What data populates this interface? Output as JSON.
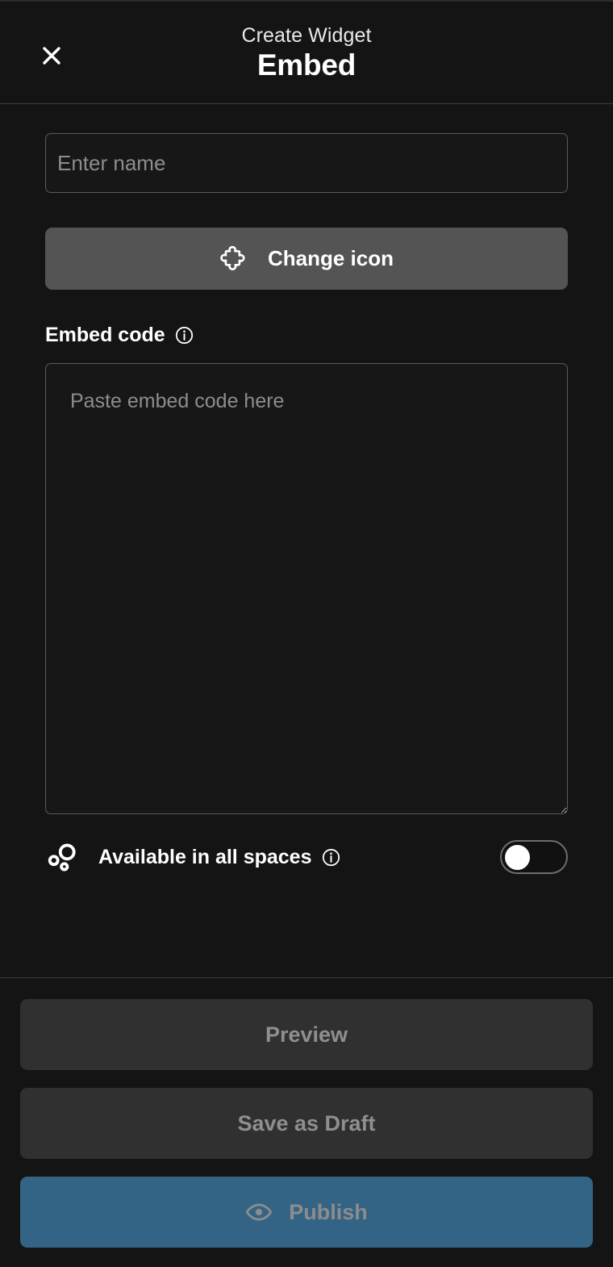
{
  "header": {
    "eyebrow": "Create Widget",
    "title": "Embed",
    "close_icon": "close-icon"
  },
  "form": {
    "name_field": {
      "value": "",
      "placeholder": "Enter name"
    },
    "change_icon_button": {
      "label": "Change icon",
      "icon": "puzzle-piece-icon"
    },
    "embed_code": {
      "label": "Embed code",
      "info_icon": "info-icon",
      "value": "",
      "placeholder": "Paste embed code here"
    },
    "available_in_all_spaces": {
      "label": "Available in all spaces",
      "icon": "spaces-icon",
      "info_icon": "info-icon",
      "toggle_state": "off"
    }
  },
  "footer": {
    "preview_label": "Preview",
    "save_draft_label": "Save as Draft",
    "publish_label": "Publish",
    "publish_icon": "eye-icon"
  },
  "colors": {
    "background": "#141414",
    "surface": "#171717",
    "button_gray": "#303030",
    "button_gray_light": "#545454",
    "accent_blue": "#336485",
    "muted_text": "#8f8f8f",
    "border": "#5a5a5a"
  }
}
